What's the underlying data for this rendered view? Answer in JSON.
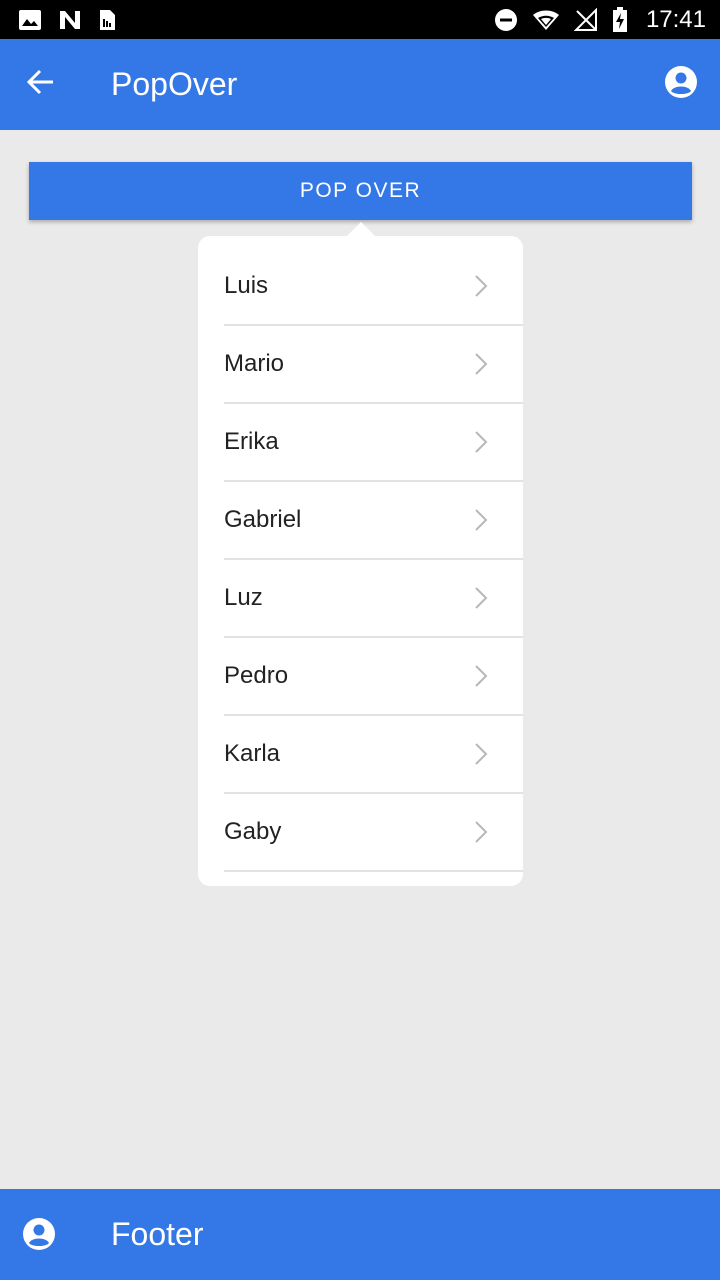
{
  "status_bar": {
    "time": "17:41",
    "icons": [
      "image-icon",
      "n-notification-icon",
      "sim-card-icon",
      "do-not-disturb-icon",
      "wifi-icon",
      "no-signal-icon",
      "battery-charging-icon"
    ]
  },
  "app_bar": {
    "title": "PopOver",
    "back_icon": "arrow-left-icon",
    "profile_icon": "account-circle-icon"
  },
  "pop_button": {
    "label": "POP OVER"
  },
  "popover": {
    "items": [
      {
        "label": "Luis"
      },
      {
        "label": "Mario"
      },
      {
        "label": "Erika"
      },
      {
        "label": "Gabriel"
      },
      {
        "label": "Luz"
      },
      {
        "label": "Pedro"
      },
      {
        "label": "Karla"
      },
      {
        "label": "Gaby"
      }
    ]
  },
  "footer": {
    "title": "Footer",
    "icon": "account-circle-icon"
  },
  "colors": {
    "primary": "#3478e8",
    "background": "#eaeaea",
    "popover_bg": "#ffffff",
    "divider": "#e2e2e2",
    "chevron": "#b8b8b8"
  }
}
